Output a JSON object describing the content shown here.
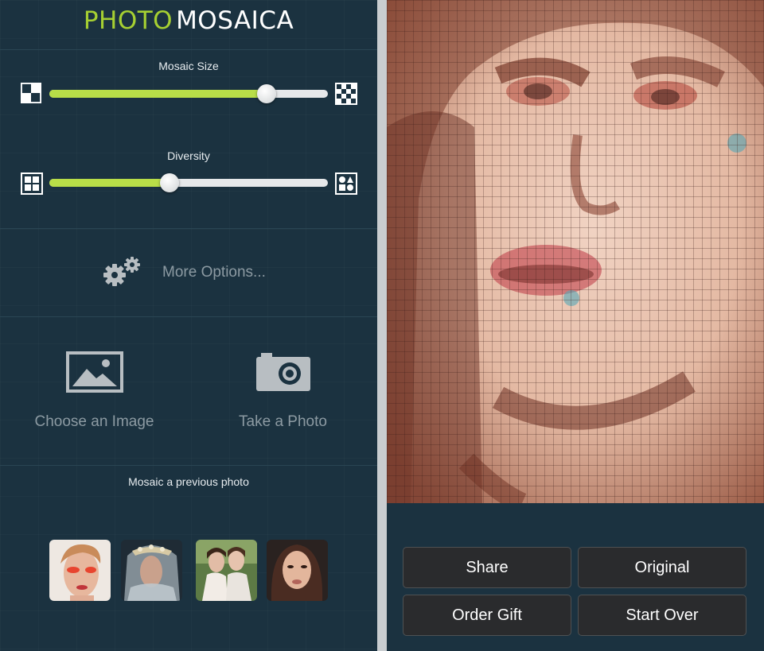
{
  "logo": {
    "part1": "PHOTO",
    "part2": "MOSAICA"
  },
  "sliders": [
    {
      "label": "Mosaic Size",
      "value": 0.78
    },
    {
      "label": "Diversity",
      "value": 0.43
    }
  ],
  "more_options": {
    "label": "More Options...",
    "icon": "gears-icon"
  },
  "actions": {
    "choose_image": {
      "label": "Choose an Image",
      "icon": "image-icon"
    },
    "take_photo": {
      "label": "Take a Photo",
      "icon": "camera-icon"
    }
  },
  "previous": {
    "label": "Mosaic a previous photo",
    "photos": [
      "previous-photo-1",
      "previous-photo-2",
      "previous-photo-3",
      "previous-photo-4"
    ]
  },
  "buttons": {
    "share": "Share",
    "original": "Original",
    "order_gift": "Order Gift",
    "start_over": "Start Over"
  },
  "colors": {
    "accent": "#a6d032",
    "slider_fill": "#b8de48",
    "background": "#1b3240",
    "button": "#2a2b2d"
  }
}
